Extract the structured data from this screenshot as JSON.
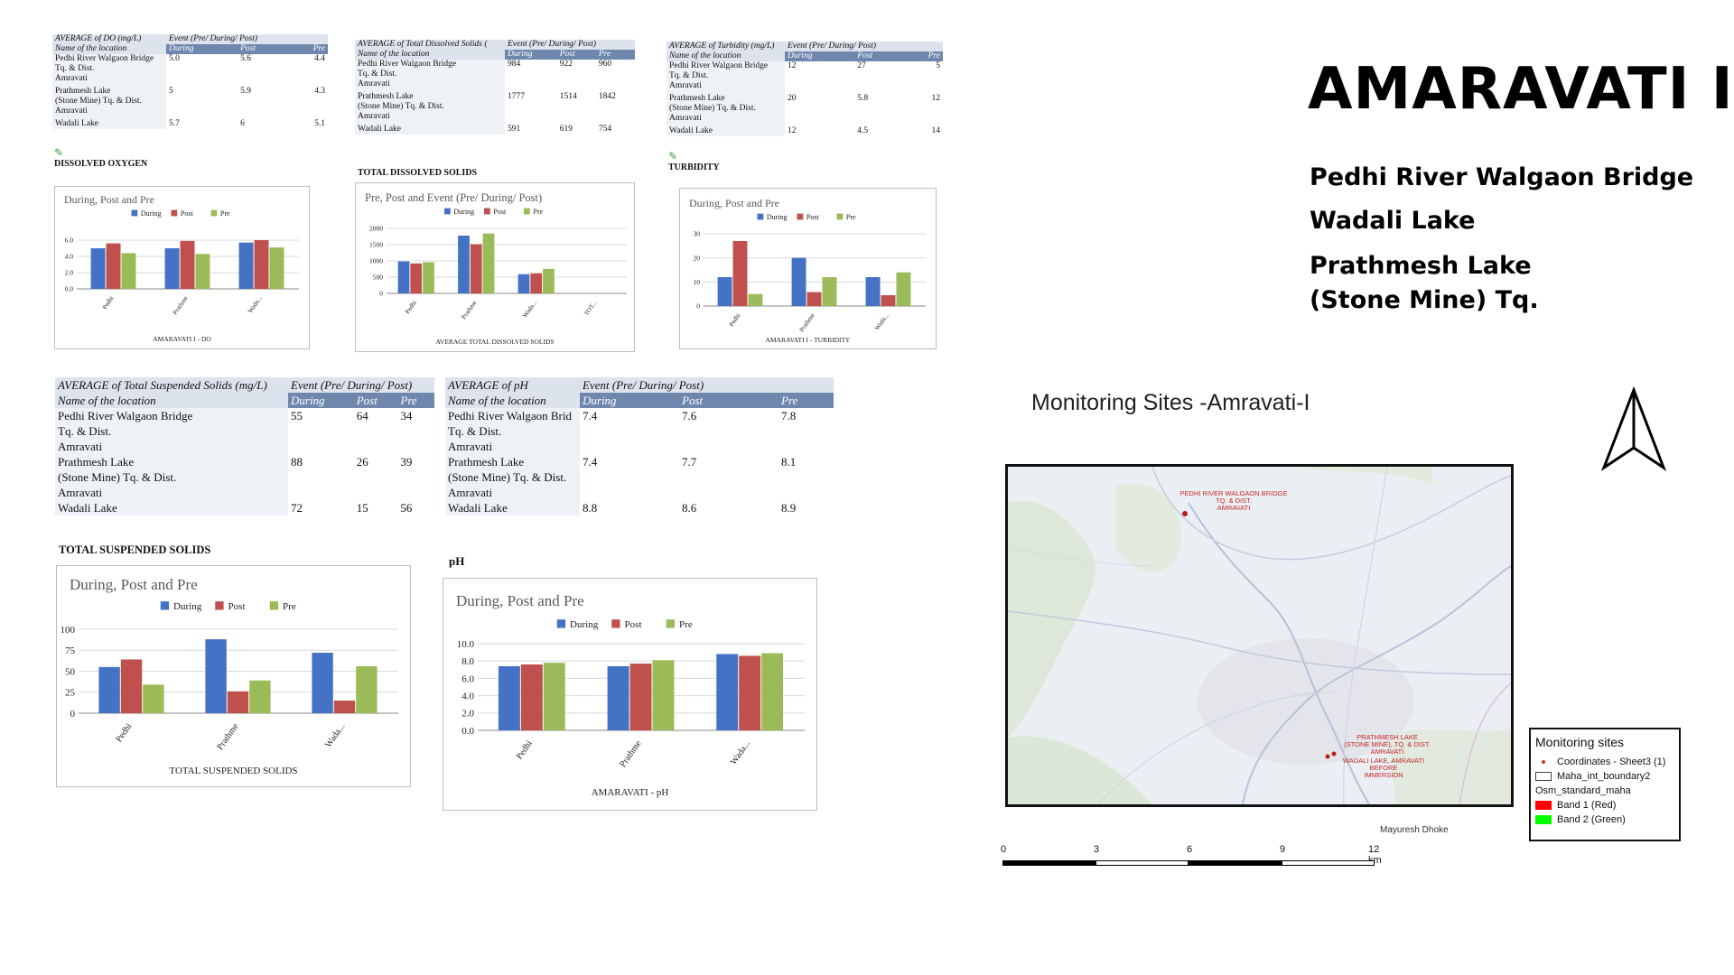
{
  "header": {
    "title": "AMARAVATI I",
    "sites": [
      "Pedhi River Walgaon Bridge",
      "Wadali Lake",
      "Prathmesh Lake",
      "(Stone Mine) Tq."
    ]
  },
  "tables": {
    "do": {
      "title": "AVERAGE of DO (mg/L)",
      "event": "Event (Pre/ During/ Post)",
      "loc_header": "Name of the location",
      "cols": [
        "During",
        "Post",
        "Pre"
      ],
      "rows": [
        {
          "loc": [
            "Pedhi River Walgaon Bridge",
            "Tq. & Dist.",
            "Amravati"
          ],
          "vals": [
            "5.0",
            "5.6",
            "4.4"
          ]
        },
        {
          "loc": [
            "Prathmesh Lake",
            "(Stone Mine) Tq. & Dist.",
            "Amravati"
          ],
          "vals": [
            "5",
            "5.9",
            "4.3"
          ]
        },
        {
          "loc": [
            "Wadali Lake"
          ],
          "vals": [
            "5.7",
            "6",
            "5.1"
          ]
        }
      ],
      "section": "DISSOLVED OXYGEN"
    },
    "tds": {
      "title": "AVERAGE of Total Dissolved Solids (",
      "event": "Event (Pre/ During/ Post)",
      "loc_header": "Name of the location",
      "cols": [
        "During",
        "Post",
        "Pre"
      ],
      "rows": [
        {
          "loc": [
            "Pedhi River Walgaon Bridge",
            "Tq. & Dist.",
            "Amravati"
          ],
          "vals": [
            "984",
            "922",
            "960"
          ]
        },
        {
          "loc": [
            "Prathmesh Lake",
            "(Stone Mine) Tq. & Dist.",
            "Amravati"
          ],
          "vals": [
            "1777",
            "1514",
            "1842"
          ]
        },
        {
          "loc": [
            "Wadali Lake"
          ],
          "vals": [
            "591",
            "619",
            "754"
          ]
        }
      ],
      "section": "TOTAL DISSOLVED SOLIDS"
    },
    "turb": {
      "title": "AVERAGE of Turbidity (mg/L)",
      "event": "Event (Pre/ During/ Post)",
      "loc_header": "Name of the location",
      "cols": [
        "During",
        "Post",
        "Pre"
      ],
      "rows": [
        {
          "loc": [
            "Pedhi River Walgaon Bridge",
            "Tq. & Dist.",
            "Amravati"
          ],
          "vals": [
            "12",
            "27",
            "5"
          ]
        },
        {
          "loc": [
            "Prathmesh Lake",
            "(Stone Mine) Tq. & Dist.",
            "Amravati"
          ],
          "vals": [
            "20",
            "5.8",
            "12"
          ]
        },
        {
          "loc": [
            "Wadali Lake"
          ],
          "vals": [
            "12",
            "4.5",
            "14"
          ]
        }
      ],
      "section": "TURBIDITY"
    },
    "tss": {
      "title": "AVERAGE of Total Suspended Solids (mg/L)",
      "event": "Event (Pre/ During/ Post)",
      "loc_header": "Name of the location",
      "cols": [
        "During",
        "Post",
        "Pre"
      ],
      "rows": [
        {
          "loc": [
            "Pedhi River Walgaon Bridge",
            "Tq. & Dist.",
            "Amravati"
          ],
          "vals": [
            "55",
            "64",
            "34"
          ]
        },
        {
          "loc": [
            "Prathmesh Lake",
            "(Stone Mine) Tq. & Dist.",
            "Amravati"
          ],
          "vals": [
            "88",
            "26",
            "39"
          ]
        },
        {
          "loc": [
            "Wadali Lake"
          ],
          "vals": [
            "72",
            "15",
            "56"
          ]
        }
      ],
      "section": "TOTAL SUSPENDED SOLIDS"
    },
    "ph": {
      "title": "AVERAGE of pH",
      "event": "Event (Pre/ During/ Post)",
      "loc_header": "Name of the location",
      "cols": [
        "During",
        "Post",
        "Pre"
      ],
      "rows": [
        {
          "loc": [
            "Pedhi River Walgaon Brid",
            "Tq. & Dist.",
            "Amravati"
          ],
          "vals": [
            "7.4",
            "7.6",
            "7.8"
          ]
        },
        {
          "loc": [
            "Prathmesh Lake",
            "(Stone Mine) Tq. & Dist.",
            "Amravati"
          ],
          "vals": [
            "7.4",
            "7.7",
            "8.1"
          ]
        },
        {
          "loc": [
            "Wadali Lake"
          ],
          "vals": [
            "8.8",
            "8.6",
            "8.9"
          ]
        }
      ],
      "section": "pH"
    }
  },
  "chart_data": [
    {
      "id": "do",
      "type": "bar",
      "title": "During, Post and Pre",
      "categories": [
        "Pedhi",
        "Prathme",
        "Wada..."
      ],
      "series": [
        {
          "name": "During",
          "values": [
            5.0,
            5.0,
            5.7
          ],
          "color": "#4472c4"
        },
        {
          "name": "Post",
          "values": [
            5.6,
            5.9,
            6.0
          ],
          "color": "#c0504d"
        },
        {
          "name": "Pre",
          "values": [
            4.4,
            4.3,
            5.1
          ],
          "color": "#9bbb59"
        }
      ],
      "yticks": [
        "0.0",
        "2.0",
        "4.0",
        "6.0"
      ],
      "ylim": [
        0,
        7
      ],
      "xlabel": "AMARAVATI I - DO",
      "legend": "top"
    },
    {
      "id": "tds",
      "type": "bar",
      "title": "Pre, Post and Event (Pre/ During/ Post)",
      "categories": [
        "Pedhi",
        "Prathme",
        "Wada...",
        "TOT..."
      ],
      "series": [
        {
          "name": "During",
          "values": [
            984,
            1777,
            591,
            0
          ],
          "color": "#4472c4"
        },
        {
          "name": "Post",
          "values": [
            922,
            1514,
            619,
            0
          ],
          "color": "#c0504d"
        },
        {
          "name": "Pre",
          "values": [
            960,
            1842,
            754,
            0
          ],
          "color": "#9bbb59"
        }
      ],
      "yticks": [
        "0",
        "500",
        "1000",
        "1500",
        "2000"
      ],
      "ylim": [
        0,
        2000
      ],
      "xlabel": "AVERAGE TOTAL DISSOLVED SOLIDS",
      "legend": "top"
    },
    {
      "id": "turb",
      "type": "bar",
      "title": "During, Post and Pre",
      "categories": [
        "Pedhi",
        "Prathme",
        "Wada..."
      ],
      "series": [
        {
          "name": "During",
          "values": [
            12,
            20,
            12
          ],
          "color": "#4472c4"
        },
        {
          "name": "Post",
          "values": [
            27,
            5.8,
            4.5
          ],
          "color": "#c0504d"
        },
        {
          "name": "Pre",
          "values": [
            5,
            12,
            14
          ],
          "color": "#9bbb59"
        }
      ],
      "yticks": [
        "0",
        "10",
        "20",
        "30"
      ],
      "ylim": [
        0,
        30
      ],
      "xlabel": "AMARAVATI I - TURBIDITY",
      "legend": "top"
    },
    {
      "id": "tss",
      "type": "bar",
      "title": "During, Post and Pre",
      "categories": [
        "Pedhi",
        "Prathme",
        "Wada..."
      ],
      "series": [
        {
          "name": "During",
          "values": [
            55,
            88,
            72
          ],
          "color": "#4472c4"
        },
        {
          "name": "Post",
          "values": [
            64,
            26,
            15
          ],
          "color": "#c0504d"
        },
        {
          "name": "Pre",
          "values": [
            34,
            39,
            56
          ],
          "color": "#9bbb59"
        }
      ],
      "yticks": [
        "0",
        "25",
        "50",
        "75",
        "100"
      ],
      "ylim": [
        0,
        100
      ],
      "xlabel": "TOTAL SUSPENDED SOLIDS",
      "legend": "top"
    },
    {
      "id": "ph",
      "type": "bar",
      "title": "During, Post and Pre",
      "categories": [
        "Pedhi",
        "Prathme",
        "Wada..."
      ],
      "series": [
        {
          "name": "During",
          "values": [
            7.4,
            7.4,
            8.8
          ],
          "color": "#4472c4"
        },
        {
          "name": "Post",
          "values": [
            7.6,
            7.7,
            8.6
          ],
          "color": "#c0504d"
        },
        {
          "name": "Pre",
          "values": [
            7.8,
            8.1,
            8.9
          ],
          "color": "#9bbb59"
        }
      ],
      "yticks": [
        "0.0",
        "2.0",
        "4.0",
        "6.0",
        "8.0",
        "10.0"
      ],
      "ylim": [
        0,
        10
      ],
      "xlabel": "AMARAVATI - pH",
      "legend": "top"
    }
  ],
  "map": {
    "title": "Monitoring Sites -Amravati-I",
    "labels": {
      "pedhi": [
        "PEDHI RIVER WALGAON BRIDGE",
        "TQ. & DIST.",
        "AMRAVATI"
      ],
      "prathmesh": [
        "PRATHMESH LAKE",
        "(STONE MINE), TQ. & DIST.",
        "AMRAVATI"
      ],
      "wadali": [
        "WADALI LAKE, AMRAVATI",
        "BEFORE",
        "IMMERSION"
      ]
    },
    "legend": {
      "title": "Monitoring sites",
      "items": [
        {
          "label": "Coordinates - Sheet3 (1)",
          "kind": "dot",
          "color": "#d32f2f"
        },
        {
          "label": "Maha_int_boundary2",
          "kind": "box",
          "color": "#ffffff"
        },
        {
          "label": "Osm_standard_maha",
          "kind": "none",
          "color": ""
        },
        {
          "label": "Band 1 (Red)",
          "kind": "fill",
          "color": "#ff0000"
        },
        {
          "label": "Band 2 (Green)",
          "kind": "fill",
          "color": "#00ff00"
        }
      ]
    },
    "author": "Mayuresh Dhoke",
    "scale": {
      "ticks": [
        "0",
        "3",
        "6",
        "9",
        "12 km"
      ]
    }
  }
}
